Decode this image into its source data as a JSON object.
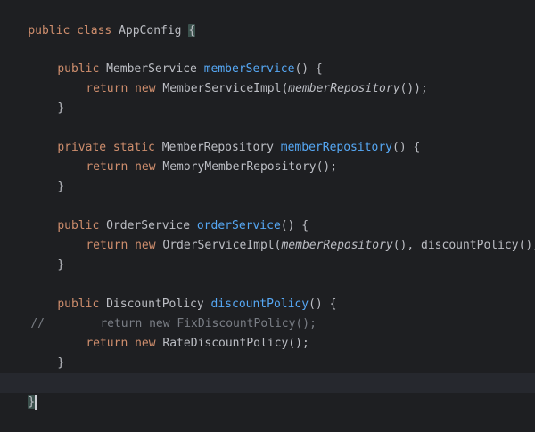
{
  "code": {
    "l1": {
      "kw": "public class ",
      "name": "AppConfig ",
      "brace": "{"
    },
    "l3": {
      "kw": "public ",
      "type": "MemberService ",
      "fn": "memberService",
      "rest": "() {"
    },
    "l4": {
      "kw": "return new ",
      "a": "MemberServiceImpl(",
      "call": "memberRepository",
      "b": "());"
    },
    "l5": {
      "text": "}"
    },
    "l7": {
      "kw": "private static ",
      "type": "MemberRepository ",
      "fn": "memberRepository",
      "rest": "() {"
    },
    "l8": {
      "kw": "return new ",
      "a": "MemoryMemberRepository();"
    },
    "l9": {
      "text": "}"
    },
    "l11": {
      "kw": "public ",
      "type": "OrderService ",
      "fn": "orderService",
      "rest": "() {"
    },
    "l12": {
      "kw": "return new ",
      "a": "OrderServiceImpl(",
      "call": "memberRepository",
      "b": "(), discountPolicy());"
    },
    "l13": {
      "text": "}"
    },
    "l15": {
      "kw": "public ",
      "type": "DiscountPolicy ",
      "fn": "discountPolicy",
      "rest": "() {"
    },
    "l16": {
      "marker": "//",
      "text": "return new FixDiscountPolicy();"
    },
    "l17": {
      "kw": "return new ",
      "a": "RateDiscountPolicy();"
    },
    "l18": {
      "text": "}"
    },
    "l20": {
      "text": "}"
    }
  }
}
